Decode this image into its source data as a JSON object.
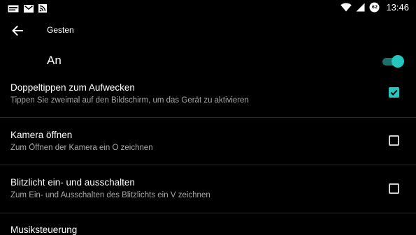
{
  "status_bar": {
    "time": "13:46",
    "battery_level": "62",
    "icons": [
      "notification-news-icon",
      "mail-icon",
      "rss-icon",
      "wifi-icon",
      "cell-signal-icon",
      "battery-icon"
    ]
  },
  "app_bar": {
    "title": "Gesten",
    "back_icon": "arrow-back-icon"
  },
  "master_switch": {
    "label": "An",
    "enabled": true
  },
  "settings": [
    {
      "title": "Doppeltippen zum Aufwecken",
      "subtitle": "Tippen Sie zweimal auf den Bildschirm, um das Gerät zu aktivieren",
      "checked": true
    },
    {
      "title": "Kamera öffnen",
      "subtitle": "Zum Öffnen der Kamera ein O zeichnen",
      "checked": false
    },
    {
      "title": "Blitzlicht ein- und ausschalten",
      "subtitle": "Zum Ein- und Ausschalten des Blitzlichts ein V zeichnen",
      "checked": false
    },
    {
      "title": "Musiksteuerung"
    }
  ],
  "colors": {
    "accent": "#26c6c0",
    "accent_dark": "#1d6f6a",
    "background": "#000000",
    "secondary_text": "#a8a8a8"
  }
}
